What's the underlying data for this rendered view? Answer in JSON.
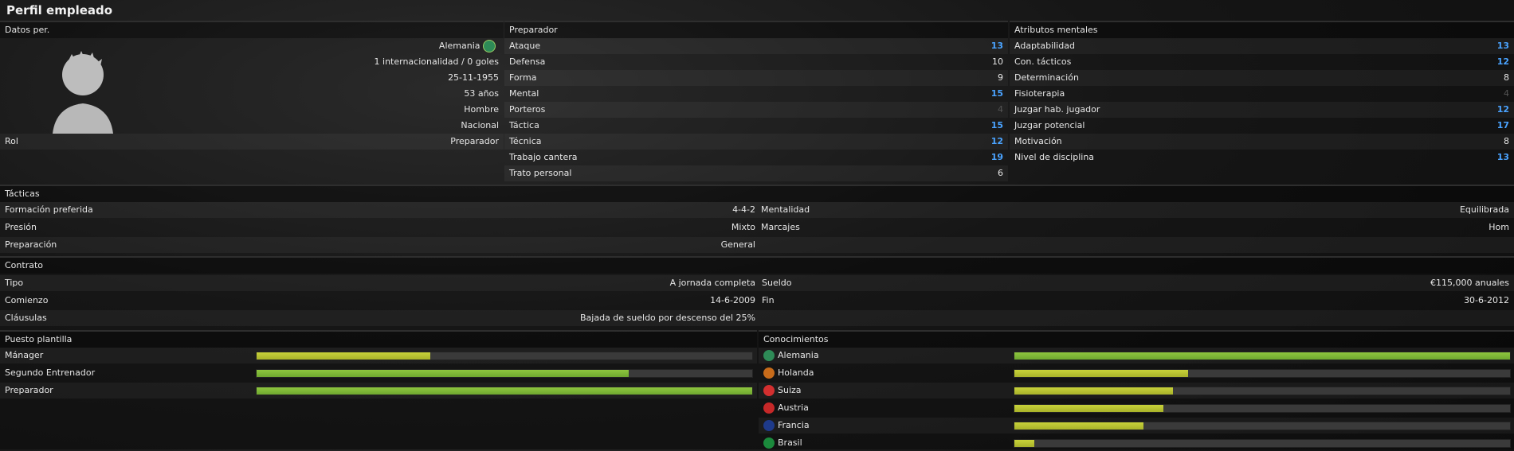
{
  "title": "Perfil empleado",
  "personal": {
    "header": "Datos per.",
    "nationality": "Alemania",
    "caps": "1 internacionalidad / 0 goles",
    "birthdate": "25-11-1955",
    "age": "53 años",
    "gender": "Hombre",
    "status": "Nacional",
    "role_label": "Rol",
    "role_value": "Preparador"
  },
  "coaching": {
    "header": "Preparador",
    "rows": [
      {
        "label": "Ataque",
        "value": "13",
        "highlight": true
      },
      {
        "label": "Defensa",
        "value": "10",
        "highlight": false
      },
      {
        "label": "Forma",
        "value": "9",
        "highlight": false
      },
      {
        "label": "Mental",
        "value": "15",
        "highlight": true
      },
      {
        "label": "Porteros",
        "value": "4",
        "dim": true
      },
      {
        "label": "Táctica",
        "value": "15",
        "highlight": true
      },
      {
        "label": "Técnica",
        "value": "12",
        "highlight": true
      },
      {
        "label": "Trabajo cantera",
        "value": "19",
        "highlight": true
      },
      {
        "label": "Trato personal",
        "value": "6",
        "highlight": false
      }
    ]
  },
  "mental": {
    "header": "Atributos mentales",
    "rows": [
      {
        "label": "Adaptabilidad",
        "value": "13",
        "highlight": true
      },
      {
        "label": "Con. tácticos",
        "value": "12",
        "highlight": true
      },
      {
        "label": "Determinación",
        "value": "8",
        "highlight": false
      },
      {
        "label": "Fisioterapia",
        "value": "4",
        "dim": true
      },
      {
        "label": "Juzgar hab. jugador",
        "value": "12",
        "highlight": true
      },
      {
        "label": "Juzgar potencial",
        "value": "17",
        "highlight": true
      },
      {
        "label": "Motivación",
        "value": "8",
        "highlight": false
      },
      {
        "label": "Nivel de disciplina",
        "value": "13",
        "highlight": true
      }
    ]
  },
  "tactics": {
    "header": "Tácticas",
    "formation_label": "Formación preferida",
    "formation_value": "4-4-2",
    "mentality_label": "Mentalidad",
    "mentality_value": "Equilibrada",
    "pressing_label": "Presión",
    "pressing_value": "Mixto",
    "marking_label": "Marcajes",
    "marking_value": "Hom",
    "training_label": "Preparación",
    "training_value": "General"
  },
  "contract": {
    "header": "Contrato",
    "type_label": "Tipo",
    "type_value": "A jornada completa",
    "salary_label": "Sueldo",
    "salary_value": "€115,000 anuales",
    "start_label": "Comienzo",
    "start_value": "14-6-2009",
    "end_label": "Fin",
    "end_value": "30-6-2012",
    "clauses_label": "Cláusulas",
    "clauses_value": "Bajada de sueldo por descenso del 25%"
  },
  "squad_role": {
    "header": "Puesto plantilla",
    "rows": [
      {
        "label": "Mánager",
        "fraction": 0.35,
        "color": "lime"
      },
      {
        "label": "Segundo Entrenador",
        "fraction": 0.75,
        "color": "green"
      },
      {
        "label": "Preparador",
        "fraction": 1.0,
        "color": "green"
      }
    ]
  },
  "knowledge": {
    "header": "Conocimientos",
    "rows": [
      {
        "label": "Alemania",
        "fraction": 1.0,
        "color": "green",
        "flag": "#2e8b57"
      },
      {
        "label": "Holanda",
        "fraction": 0.35,
        "color": "lime",
        "flag": "#c76b1a"
      },
      {
        "label": "Suiza",
        "fraction": 0.32,
        "color": "lime",
        "flag": "#d32f2f"
      },
      {
        "label": "Austria",
        "fraction": 0.3,
        "color": "lime",
        "flag": "#c62828"
      },
      {
        "label": "Francia",
        "fraction": 0.26,
        "color": "lime",
        "flag": "#1e3a8a"
      },
      {
        "label": "Brasil",
        "fraction": 0.04,
        "color": "lime",
        "flag": "#1b8a3c"
      }
    ]
  }
}
